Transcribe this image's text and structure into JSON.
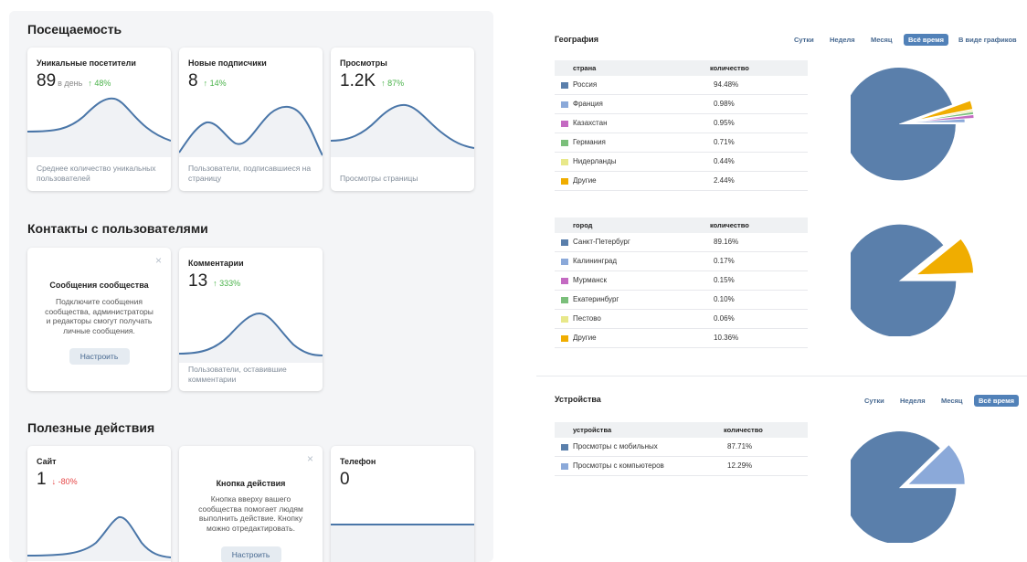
{
  "visits": {
    "title": "Посещаемость",
    "cards": [
      {
        "title": "Уникальные посетители",
        "value": "89",
        "unit": "в день",
        "delta": "↑ 48%",
        "footer": [
          "Среднее количество уникальных",
          "пользователей"
        ]
      },
      {
        "title": "Новые подписчики",
        "value": "8",
        "unit": "",
        "delta": "↑ 14%",
        "footer": [
          "Пользователи, подписавшиеся на",
          "страницу"
        ]
      },
      {
        "title": "Просмотры",
        "value": "1.2K",
        "unit": "",
        "delta": "↑ 87%",
        "footer": [
          "Просмотры страницы"
        ]
      }
    ]
  },
  "contacts": {
    "title": "Контакты с пользователями",
    "messages_card": {
      "close": "×",
      "title": "Сообщения сообщества",
      "text": [
        "Подключите сообщения",
        "сообщества, администраторы",
        "и редакторы смогут получать",
        "личные сообщения."
      ],
      "button": "Настроить"
    },
    "comments_card": {
      "title": "Комментарии",
      "value": "13",
      "delta": "↑ 333%",
      "footer": [
        "Пользователи, оставившие",
        "комментарии"
      ]
    }
  },
  "actions": {
    "title": "Полезные действия",
    "site_card": {
      "title": "Сайт",
      "value": "1",
      "delta": "↓ -80%"
    },
    "action_button_card": {
      "close": "×",
      "title": "Кнопка действия",
      "text": [
        "Кнопка вверху вашего",
        "сообщества помогает людям",
        "выполнить действие. Кнопку",
        "можно отредактировать."
      ],
      "button": "Настроить"
    },
    "phone_card": {
      "title": "Телефон",
      "value": "0"
    }
  },
  "geography": {
    "title": "География",
    "periods": [
      "Сутки",
      "Неделя",
      "Месяц",
      "Всё время"
    ],
    "active_period": "Всё время",
    "view_link": "В виде графиков",
    "country_table": {
      "col1": "страна",
      "col2": "количество",
      "rows": [
        {
          "name": "Россия",
          "value": "94.48%",
          "color": "#5a7fab"
        },
        {
          "name": "Франция",
          "value": "0.98%",
          "color": "#8ba9d9"
        },
        {
          "name": "Казахстан",
          "value": "0.95%",
          "color": "#c46ac2"
        },
        {
          "name": "Германия",
          "value": "0.71%",
          "color": "#7bbf7b"
        },
        {
          "name": "Нидерланды",
          "value": "0.44%",
          "color": "#e8e88a"
        },
        {
          "name": "Другие",
          "value": "2.44%",
          "color": "#f0ad00"
        }
      ]
    },
    "city_table": {
      "col1": "город",
      "col2": "количество",
      "rows": [
        {
          "name": "Санкт-Петербург",
          "value": "89.16%",
          "color": "#5a7fab"
        },
        {
          "name": "Калининград",
          "value": "0.17%",
          "color": "#8ba9d9"
        },
        {
          "name": "Мурманск",
          "value": "0.15%",
          "color": "#c46ac2"
        },
        {
          "name": "Екатеринбург",
          "value": "0.10%",
          "color": "#7bbf7b"
        },
        {
          "name": "Пестово",
          "value": "0.06%",
          "color": "#e8e88a"
        },
        {
          "name": "Другие",
          "value": "10.36%",
          "color": "#f0ad00"
        }
      ]
    }
  },
  "devices": {
    "title": "Устройства",
    "periods": [
      "Сутки",
      "Неделя",
      "Месяц",
      "Всё время"
    ],
    "active_period": "Всё время",
    "table": {
      "col1": "устройства",
      "col2": "количество",
      "rows": [
        {
          "name": "Просмотры с мобильных",
          "value": "87.71%",
          "color": "#5a7fab"
        },
        {
          "name": "Просмотры с компьютеров",
          "value": "12.29%",
          "color": "#8ba9d9"
        }
      ]
    }
  }
}
